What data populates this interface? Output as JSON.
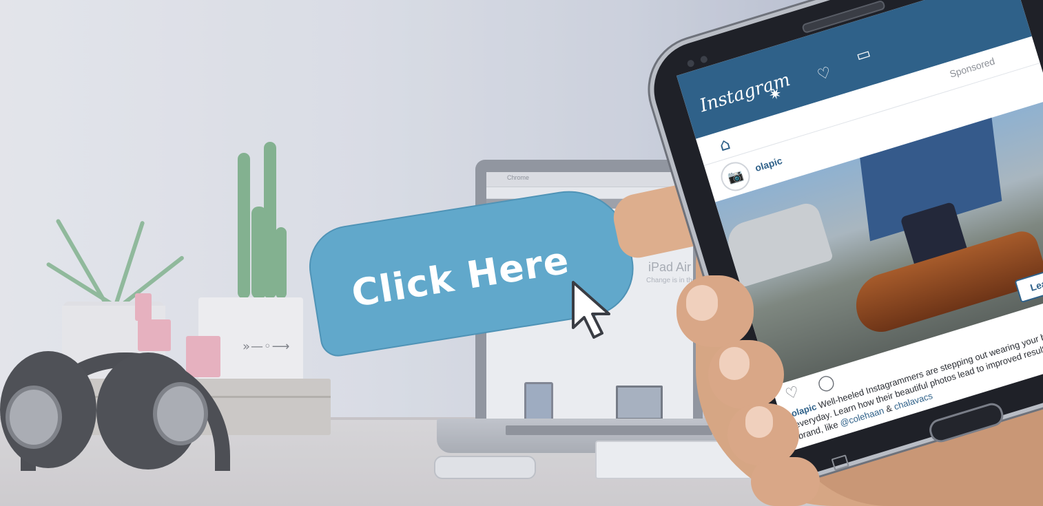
{
  "cta": {
    "label": "Click Here",
    "color": "#61a8cb",
    "cursor_icon": "pointer-arrow-icon"
  },
  "laptop": {
    "browser_title": "Chrome",
    "page_title": "iPad Air 2",
    "page_subtitle": "Change is in the air."
  },
  "instagram": {
    "app_name": "Instagram",
    "brand_color": "#2f6189",
    "header_icons": [
      "home-icon",
      "explore-star-icon",
      "activity-icon",
      "inbox-icon"
    ],
    "sponsored_label": "Sponsored",
    "post": {
      "username": "olapic",
      "avatar_icon": "camera-icon",
      "cta_button": "Learn More",
      "action_icons": [
        "heart-icon",
        "comment-icon"
      ],
      "caption_user": "olapic",
      "caption_text": "Well-heeled Instagrammers are stepping out wearing your brand everyday. Learn how their beautiful photos lead to improved results for your brand, like",
      "mention_1": "@colehaan",
      "separator": "&",
      "mention_2": "chalavacs"
    }
  }
}
